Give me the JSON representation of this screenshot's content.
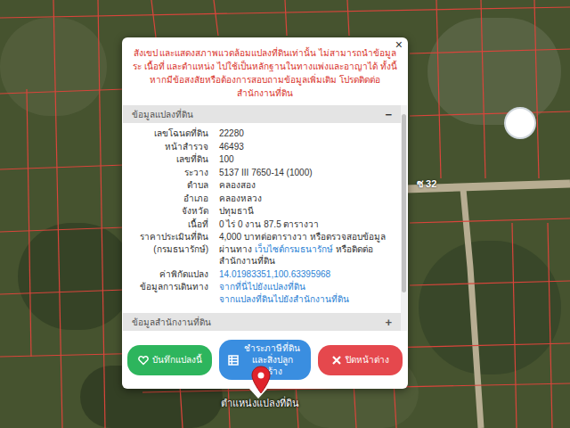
{
  "map": {
    "road_label": "ซ 32",
    "pin_label": "ตำแหน่งแปลงที่ดิน"
  },
  "popup": {
    "close": "×",
    "notice": "สังเขป และแสดงสภาพแวดล้อมแปลงที่ดินเท่านั้น ไม่สามารถนำข้อมูลระ เนื้อที่ และตำแหน่ง ไปใช้เป็นหลักฐานในทางแพ่งและอาญาได้ ทั้งนี้ หากมีข้อสงสัยหรือต้องการสอบถามข้อมูลเพิ่มเติม โปรดติดต่อสำนักงานที่ดิน",
    "parcel_section": {
      "title": "ข้อมูลแปลงที่ดิน",
      "toggle": "−",
      "expanded": true,
      "rows": [
        {
          "label": "เลขโฉนดที่ดิน",
          "parts": [
            {
              "kind": "text",
              "text": "22280"
            }
          ]
        },
        {
          "label": "หน้าสำรวจ",
          "parts": [
            {
              "kind": "text",
              "text": "46493"
            }
          ]
        },
        {
          "label": "เลขที่ดิน",
          "parts": [
            {
              "kind": "text",
              "text": "100"
            }
          ]
        },
        {
          "label": "ระวาง",
          "parts": [
            {
              "kind": "text",
              "text": "5137 III 7650-14 (1000)"
            }
          ]
        },
        {
          "label": "ตำบล",
          "parts": [
            {
              "kind": "text",
              "text": "คลองสอง"
            }
          ]
        },
        {
          "label": "อำเภอ",
          "parts": [
            {
              "kind": "text",
              "text": "คลองหลวง"
            }
          ]
        },
        {
          "label": "จังหวัด",
          "parts": [
            {
              "kind": "text",
              "text": "ปทุมธานี"
            }
          ]
        },
        {
          "label": "เนื้อที่",
          "parts": [
            {
              "kind": "text",
              "text": "0 ไร่ 0 งาน 87.5 ตารางวา"
            }
          ]
        },
        {
          "label": "ราคาประเมินที่ดิน (กรมธนารักษ์)",
          "parts": [
            {
              "kind": "text",
              "text": "4,000 บาทต่อตารางวา หรือตรวจสอบข้อมูลผ่านทาง "
            },
            {
              "kind": "link",
              "text": "เว็บไซต์กรมธนารักษ์"
            },
            {
              "kind": "text",
              "text": " หรือติดต่อสำนักงานที่ดิน"
            }
          ]
        },
        {
          "label": "ค่าพิกัดแปลง",
          "parts": [
            {
              "kind": "link",
              "text": "14.01983351,100.63395968"
            }
          ]
        },
        {
          "label": "ข้อมูลการเดินทาง",
          "parts": [
            {
              "kind": "linkline",
              "text": "จากที่นี่ไปยังแปลงที่ดิน"
            },
            {
              "kind": "linkline",
              "text": "จากแปลงที่ดินไปยังสำนักงานที่ดิน"
            }
          ]
        }
      ]
    },
    "office_section": {
      "title": "ข้อมูลสำนักงานที่ดิน",
      "toggle": "+",
      "expanded": false
    },
    "buttons": [
      {
        "kind": "heart",
        "label": "บันทึกแปลงนี้",
        "color": "#2db55d"
      },
      {
        "kind": "grid",
        "label": "ชำระภาษีที่ดินและสิ่งปลูกสร้าง",
        "color": "#3a8ee0"
      },
      {
        "kind": "close",
        "label": "ปิดหน้าต่าง",
        "color": "#e5484d"
      }
    ]
  }
}
